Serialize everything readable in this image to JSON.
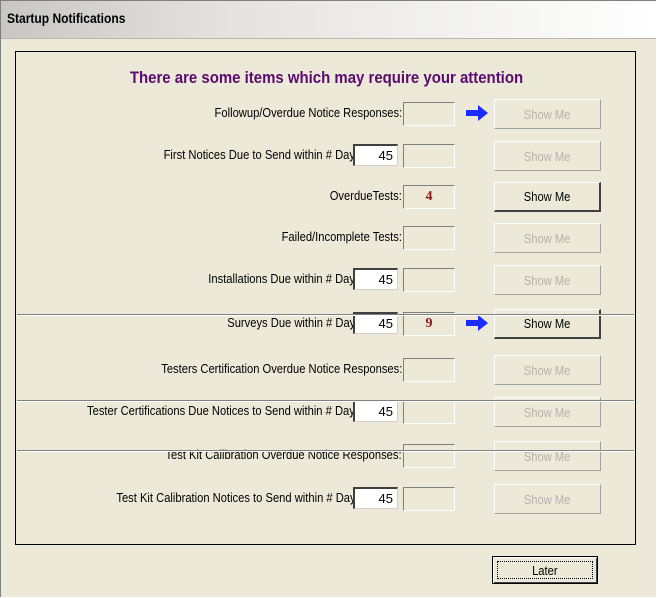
{
  "window": {
    "title": "Startup Notifications"
  },
  "heading": "There are some items which may require your attention",
  "items": [
    {
      "label": "Followup/Overdue Notice Responses:",
      "days": null,
      "count": "",
      "arrow": true,
      "button": "Show Me",
      "enabled": false
    },
    {
      "label": "First Notices Due to Send within # Days:",
      "days": "45",
      "count": "",
      "arrow": false,
      "button": "Show Me",
      "enabled": false
    },
    {
      "label": "OverdueTests:",
      "days": null,
      "count": "4",
      "arrow": false,
      "button": "Show Me",
      "enabled": true
    },
    {
      "label": "Failed/Incomplete Tests:",
      "days": null,
      "count": "",
      "arrow": false,
      "button": "Show Me",
      "enabled": false
    },
    {
      "label": "Installations Due within # Days:",
      "days": "45",
      "count": "",
      "arrow": false,
      "button": "Show Me",
      "enabled": false
    },
    {
      "label": "Surveys Due within # Days:",
      "days": "45",
      "count": "9",
      "arrow": true,
      "button": "Show Me",
      "enabled": true
    },
    {
      "label": "Testers Certification Overdue Notice Responses:",
      "days": null,
      "count": "",
      "arrow": false,
      "button": "Show Me",
      "enabled": false
    },
    {
      "label": "Tester Certifications Due Notices to Send within # Days:",
      "days": "45",
      "count": "",
      "arrow": false,
      "button": "Show Me",
      "enabled": false
    },
    {
      "label": "Test Kit Calibration Overdue Notice Responses:",
      "days": null,
      "count": "",
      "arrow": false,
      "button": "Show Me",
      "enabled": false
    },
    {
      "label": "Test Kit Calibration Notices to Send within # Days:",
      "days": "45",
      "count": "",
      "arrow": false,
      "button": "Show Me",
      "enabled": false
    }
  ],
  "later_button": "Later",
  "colors": {
    "heading": "#5b0a6e",
    "count": "#8b1a1a",
    "arrow": "#1c2bff"
  },
  "icons": {
    "arrow": "right-arrow-icon"
  }
}
